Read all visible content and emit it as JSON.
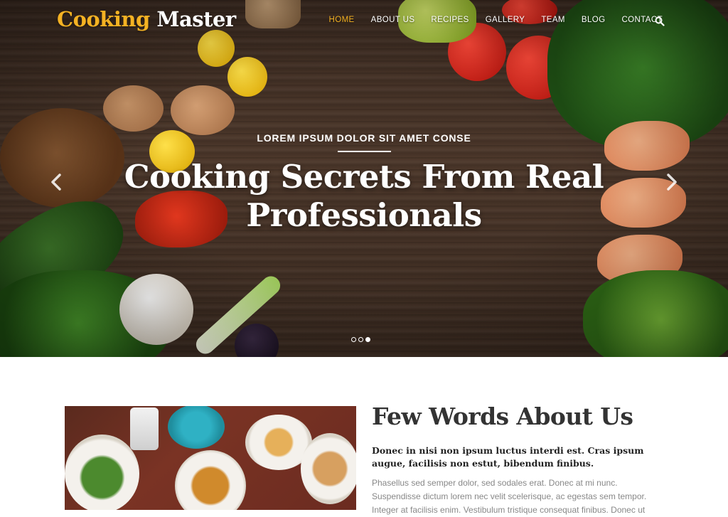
{
  "brand": {
    "part1": "Cooking",
    "part2": "Master"
  },
  "nav": {
    "items": [
      {
        "label": "HOME",
        "active": true
      },
      {
        "label": "ABOUT US",
        "active": false
      },
      {
        "label": "RECIPES",
        "active": false
      },
      {
        "label": "GALLERY",
        "active": false
      },
      {
        "label": "TEAM",
        "active": false
      },
      {
        "label": "BLOG",
        "active": false
      },
      {
        "label": "CONTACT",
        "active": false
      }
    ],
    "search_icon": "search-icon"
  },
  "slider": {
    "eyebrow": "LOREM IPSUM DOLOR SIT AMET CONSE",
    "headline_line1": "Cooking Secrets From Real",
    "headline_line2": "Professionals",
    "prev_icon": "chevron-left-icon",
    "next_icon": "chevron-right-icon",
    "slide_count": 3,
    "active_slide": 3
  },
  "about": {
    "title": "Few Words About Us",
    "lead": "Donec in nisi non ipsum luctus interdi est. Cras ipsum augue, facilisis non estut, bibendum finibus.",
    "body": "Phasellus sed semper dolor, sed sodales erat. Donec at mi nunc. Suspendisse dictum lorem nec velit scelerisque, ac egestas sem tempor. Integer at facilisis enim. Vestibulum tristique consequat finibus. Donec ut"
  },
  "colors": {
    "accent": "#f4b223",
    "hero_wood": "#4d382b",
    "text_dark": "#333333",
    "text_muted": "#888888"
  }
}
